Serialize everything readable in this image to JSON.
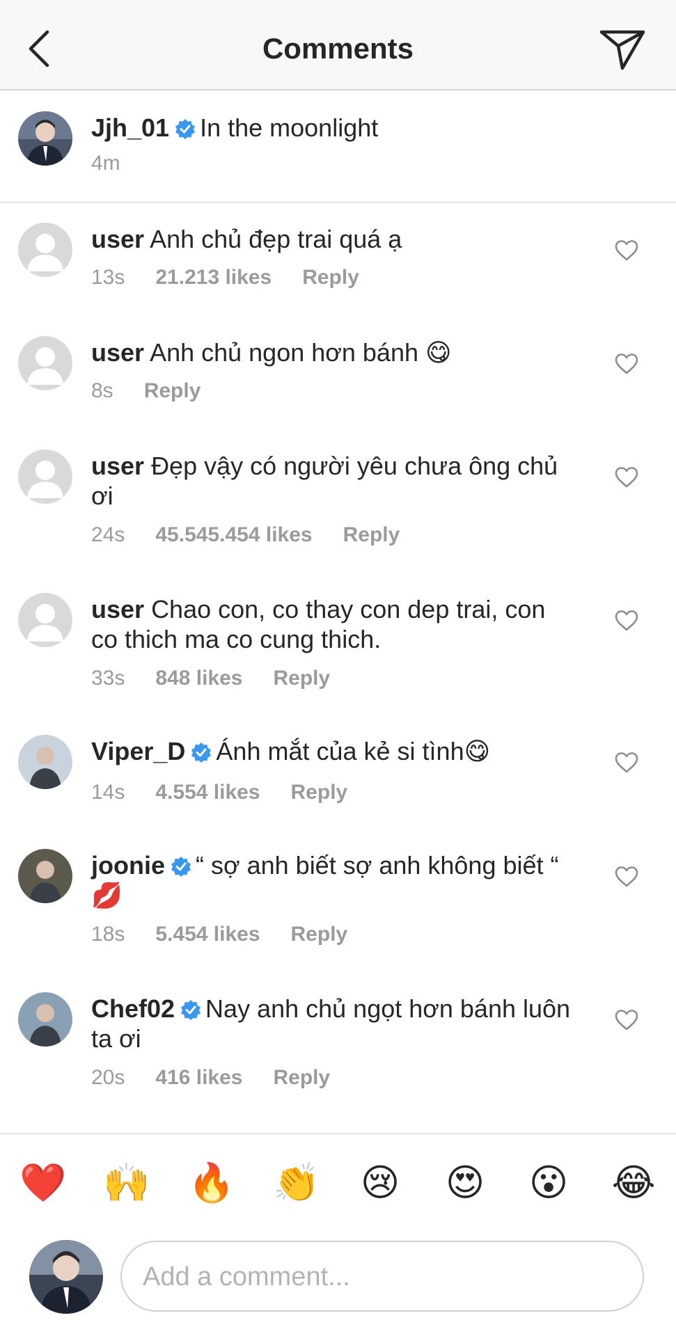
{
  "header": {
    "title": "Comments",
    "back_icon": "chevron-left-icon",
    "send_icon": "paper-plane-icon"
  },
  "caption": {
    "username": "Jjh_01",
    "text": "In the moonlight",
    "time": "4m"
  },
  "comments": [
    {
      "username": "user",
      "verified": false,
      "text": "Anh chủ đẹp trai quá ạ",
      "time": "13s",
      "likes": "21.213 likes",
      "reply": "Reply"
    },
    {
      "username": "user",
      "verified": false,
      "text": "Anh chủ ngon hơn bánh 😋",
      "time": "8s",
      "likes": "",
      "reply": "Reply"
    },
    {
      "username": "user",
      "verified": false,
      "text": "Đẹp vậy có người yêu chưa ông chủ ơi",
      "time": "24s",
      "likes": "45.545.454 likes",
      "reply": "Reply"
    },
    {
      "username": "user",
      "verified": false,
      "text": "Chao con, co thay con dep trai, con co thich ma co cung thich.",
      "time": "33s",
      "likes": "848 likes",
      "reply": "Reply"
    },
    {
      "username": "Viper_D",
      "verified": true,
      "text": "Ánh mắt của kẻ si tình😋",
      "time": "14s",
      "likes": "4.554 likes",
      "reply": "Reply"
    },
    {
      "username": "joonie",
      "verified": true,
      "text": "“ sợ anh biết sợ anh không biết “ 💋",
      "time": "18s",
      "likes": "5.454 likes",
      "reply": "Reply"
    },
    {
      "username": "Chef02",
      "verified": true,
      "text": "Nay anh chủ ngọt hơn bánh luôn ta ơi",
      "time": "20s",
      "likes": "416 likes",
      "reply": "Reply"
    }
  ],
  "reactions": [
    "❤️",
    "🙌",
    "🔥",
    "👏",
    "😢",
    "😍",
    "😮",
    "😂"
  ],
  "composer": {
    "placeholder": "Add a comment..."
  },
  "colors": {
    "verified_blue": "#3897f0",
    "meta_gray": "#9b9b9b",
    "text": "#262626"
  }
}
